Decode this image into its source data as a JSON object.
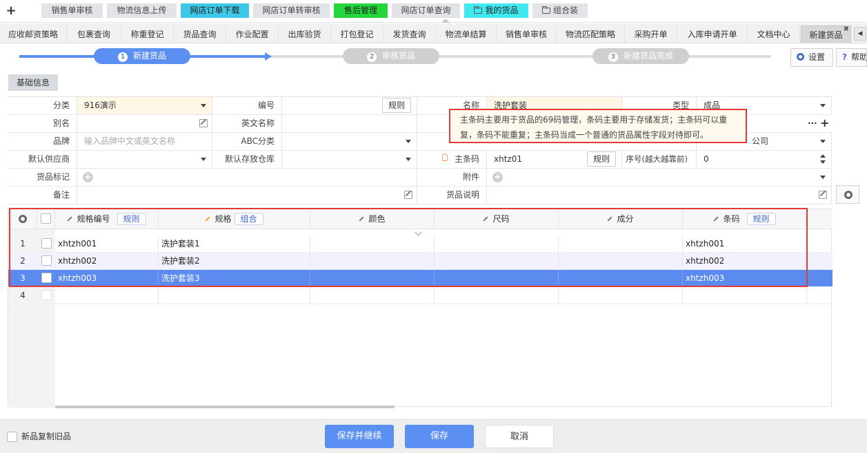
{
  "top_tabs": [
    {
      "label": "销售单审核",
      "style": "gray"
    },
    {
      "label": "物流信息上传",
      "style": "gray"
    },
    {
      "label": "网店订单下载",
      "style": "cyan"
    },
    {
      "label": "网店订单转审核",
      "style": "gray"
    },
    {
      "label": "售后管理",
      "style": "green"
    },
    {
      "label": "网店订单查询",
      "style": "gray"
    },
    {
      "label": "我的货品",
      "style": "lcyan",
      "icon": "folder-icon"
    },
    {
      "label": "组合装",
      "style": "gray",
      "icon": "folder-icon"
    }
  ],
  "nav_tabs": [
    {
      "label": "应收邮资策略"
    },
    {
      "label": "包裹查询"
    },
    {
      "label": "称重登记"
    },
    {
      "label": "货品查询"
    },
    {
      "label": "作业配置"
    },
    {
      "label": "出库验货"
    },
    {
      "label": "打包登记"
    },
    {
      "label": "发货查询"
    },
    {
      "label": "物流单结算"
    },
    {
      "label": "销售单审核"
    },
    {
      "label": "物流匹配策略"
    },
    {
      "label": "采购开单"
    },
    {
      "label": "入库申请开单"
    },
    {
      "label": "文档中心"
    },
    {
      "label": "新建货品",
      "active": true
    }
  ],
  "steps": [
    {
      "num": "1",
      "label": "新建货品",
      "active": true
    },
    {
      "num": "2",
      "label": "审核货品",
      "active": false
    },
    {
      "num": "3",
      "label": "新建货品完成",
      "active": false
    }
  ],
  "toolbar": {
    "settings": "设置",
    "help": "帮助"
  },
  "section_tab": "基础信息",
  "form": {
    "category_label": "分类",
    "category_value": "916演示",
    "code_label": "编号",
    "code_rule": "规则",
    "name_label": "名称",
    "name_value": "洗护套装",
    "type_label": "类型",
    "type_value": "成品",
    "alias_label": "别名",
    "english_label": "英文名称",
    "brand_label": "品牌",
    "brand_placeholder": "输入品牌中文或英文名称",
    "abc_label": "ABC分类",
    "supplier_right_value": "公司",
    "default_supplier_label": "默认供应商",
    "default_warehouse_label": "默认存放仓库",
    "main_barcode_label": "主条码",
    "main_barcode_value": "xhtz01",
    "main_barcode_rule": "规则",
    "seq_label": "序号(越大越靠前)",
    "seq_value": "0",
    "mark_label": "货品标记",
    "attachment_label": "附件",
    "remark_label": "备注",
    "desc_label": "货品说明"
  },
  "tooltip": {
    "line1": "主条码主要用于货品的69码管理，条码主要用于存储发货；主条码可以重",
    "line2": "复，条码不能重复；主条码当成一个普通的货品属性字段对待即可。"
  },
  "grid": {
    "columns": {
      "spec_code": "规格编号",
      "spec_code_btn": "规则",
      "spec": "规格",
      "spec_btn": "组合",
      "color": "颜色",
      "size": "尺码",
      "component": "成分",
      "barcode": "条码",
      "barcode_btn": "规则"
    },
    "rows": [
      {
        "num": "1",
        "spec_code": "xhtzh001",
        "spec": "洗护套装1",
        "color": "",
        "size": "",
        "component": "",
        "barcode": "xhtzh001"
      },
      {
        "num": "2",
        "spec_code": "xhtzh002",
        "spec": "洗护套装2",
        "color": "",
        "size": "",
        "component": "",
        "barcode": "xhtzh002"
      },
      {
        "num": "3",
        "spec_code": "xhtzh003",
        "spec": "洗护套装3",
        "color": "",
        "size": "",
        "component": "",
        "barcode": "xhtzh003"
      },
      {
        "num": "4",
        "spec_code": "",
        "spec": "",
        "color": "",
        "size": "",
        "component": "",
        "barcode": ""
      }
    ]
  },
  "footer": {
    "copy_label": "新品复制旧品",
    "save_continue": "保存并继续",
    "save": "保存",
    "cancel": "取消"
  },
  "colors": {
    "primary": "#5b8ff1",
    "highlight_border": "#e53935",
    "selected_row": "#5b8bef"
  }
}
